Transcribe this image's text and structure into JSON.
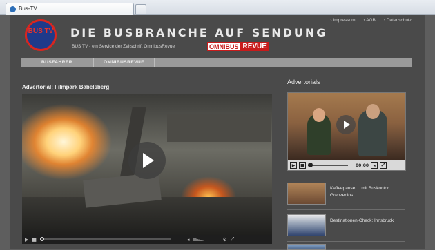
{
  "browser": {
    "tab_title": "Bus-TV"
  },
  "header": {
    "logo_text": "BUS TV",
    "site_title": "DIE BUSBRANCHE AUF SENDUNG",
    "tagline": "BUS TV - ein Service der Zeitschrift OmnibusRevue",
    "brand_omnibus": "OMNIBUS",
    "brand_revue": "REVUE",
    "top_links": [
      "› Impressum",
      "› AGB",
      "› Datenschutz"
    ]
  },
  "nav": {
    "items": [
      "BUSFAHRER",
      "OMNIBUSREVUE"
    ]
  },
  "main": {
    "heading": "Advertorial: Filmpark Babelsberg"
  },
  "sidebar": {
    "heading": "Advertorials",
    "player_time": "00:00",
    "items": [
      {
        "title": "Kaffeepause ... mit Buskontor Grenzenlos"
      },
      {
        "title": "Destinationen-Check: Innsbruck"
      }
    ]
  },
  "icons": {
    "play": "play-icon",
    "pause": "pause-icon",
    "stop": "stop-icon",
    "volume": "volume-icon",
    "fullscreen": "fullscreen-icon"
  }
}
